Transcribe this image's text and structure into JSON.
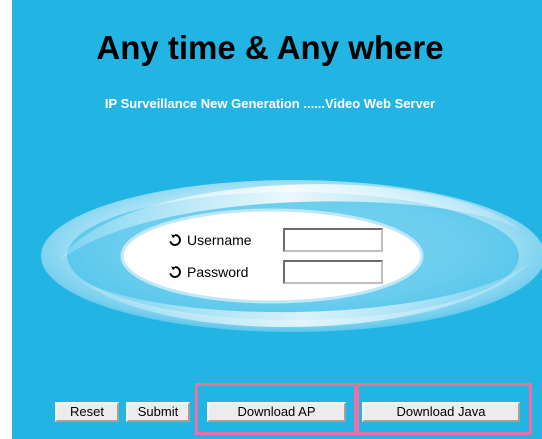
{
  "header": {
    "title": "Any time & Any where",
    "subtitle": "IP Surveillance New Generation ......Video Web Server"
  },
  "login": {
    "username_label": "Username",
    "username_value": "",
    "password_label": "Password",
    "password_value": ""
  },
  "buttons": {
    "reset": "Reset",
    "submit": "Submit",
    "download_ap": "Download AP",
    "download_java": "Download Java"
  },
  "icons": {
    "field_bullet": "arrow-circle-icon"
  },
  "colors": {
    "background": "#22b5e4",
    "ellipse_inner": "#ffffff",
    "ellipse_ring": "#7fd0ee",
    "title": "#000000",
    "subtitle": "#ffffff",
    "highlight": "#ee6fa6"
  }
}
